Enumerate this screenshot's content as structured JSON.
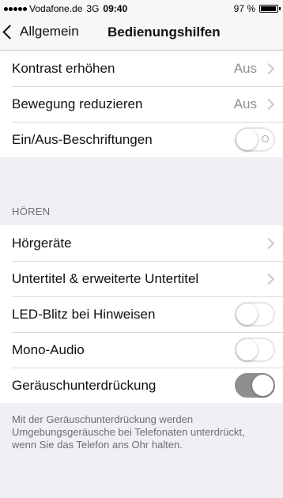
{
  "status_bar": {
    "carrier": "Vodafone.de",
    "network": "3G",
    "time": "09:40",
    "battery": "97 %",
    "battery_level": 0.97
  },
  "nav": {
    "back_label": "Allgemein",
    "title": "Bedienungshilfen"
  },
  "group1": [
    {
      "label": "Kontrast erhöhen",
      "value": "Aus"
    },
    {
      "label": "Bewegung reduzieren",
      "value": "Aus"
    },
    {
      "label": "Ein/Aus-Beschriftungen",
      "toggle": false
    }
  ],
  "section_header": "HÖREN",
  "group2": [
    {
      "label": "Hörgeräte"
    },
    {
      "label": "Untertitel & erweiterte Untertitel"
    },
    {
      "label": "LED-Blitz bei Hinweisen",
      "toggle": false
    },
    {
      "label": "Mono-Audio",
      "toggle": false
    },
    {
      "label": "Geräuschunterdrückung",
      "toggle": true
    }
  ],
  "footer": "Mit der Geräuschunterdrückung werden Umgebungsgeräusche bei Telefonaten unterdrückt, wenn Sie das Telefon ans Ohr halten."
}
